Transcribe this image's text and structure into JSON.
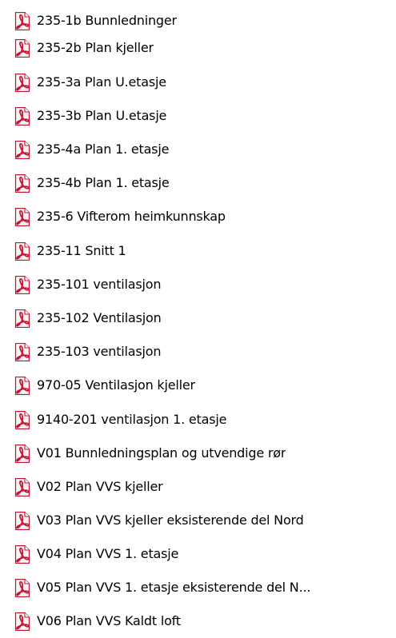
{
  "file_list": {
    "icon": "pdf-file-icon",
    "colors": {
      "icon_red": "#c8102e",
      "icon_page": "#f4f4f4",
      "text": "#000000"
    },
    "items": [
      {
        "name": "235-1b Bunnledninger"
      },
      {
        "name": "235-2b Plan kjeller"
      },
      {
        "name": "235-3a Plan U.etasje"
      },
      {
        "name": "235-3b Plan U.etasje"
      },
      {
        "name": "235-4a Plan 1. etasje"
      },
      {
        "name": "235-4b Plan 1. etasje"
      },
      {
        "name": "235-6 Vifterom heimkunnskap"
      },
      {
        "name": "235-11 Snitt 1"
      },
      {
        "name": "235-101 ventilasjon"
      },
      {
        "name": "235-102 Ventilasjon"
      },
      {
        "name": "235-103 ventilasjon"
      },
      {
        "name": "970-05 Ventilasjon kjeller"
      },
      {
        "name": "9140-201 ventilasjon 1. etasje"
      },
      {
        "name": "V01 Bunnledningsplan og utvendige rør"
      },
      {
        "name": "V02 Plan VVS kjeller"
      },
      {
        "name": "V03 Plan VVS kjeller eksisterende del Nord"
      },
      {
        "name": "V04 Plan VVS 1. etasje"
      },
      {
        "name": "V05 Plan VVS 1. etasje eksisterende del N..."
      },
      {
        "name": "V06 Plan VVS Kaldt loft"
      }
    ]
  }
}
